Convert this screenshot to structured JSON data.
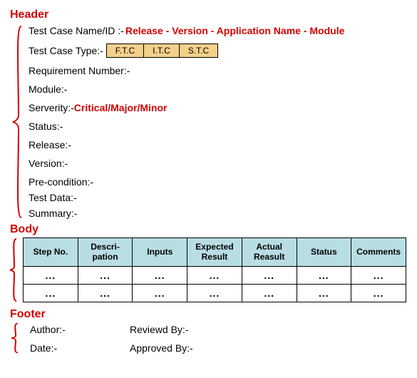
{
  "sections": {
    "header_title": "Header",
    "body_title": "Body",
    "footer_title": "Footer"
  },
  "header": {
    "name_id_label": "Test Case Name/ID :-",
    "name_id_value": "Release - Version - Application Name - Module",
    "type_label": "Test Case Type:-",
    "type_options": [
      "F.T.C",
      "I.T.C",
      "S.T.C"
    ],
    "requirement_label": "Requirement Number:-",
    "module_label": "Module:-",
    "severity_label": "Serverity:- ",
    "severity_value": "Critical/Major/Minor",
    "status_label": "Status:-",
    "release_label": "Release:-",
    "version_label": "Version:-",
    "precondition_label": "Pre-condition:-",
    "testdata_label": "Test Data:-",
    "summary_label": "Summary:-"
  },
  "body": {
    "columns": [
      "Step No.",
      "Descri-\npation",
      "Inputs",
      "Expected\nResult",
      "Actual\nReasult",
      "Status",
      "Comments"
    ],
    "rows": [
      [
        "...",
        "...",
        "...",
        "...",
        "...",
        "...",
        "..."
      ],
      [
        "...",
        "...",
        "...",
        "...",
        "...",
        "...",
        "..."
      ]
    ]
  },
  "footer": {
    "author_label": "Author:-",
    "reviewed_label": "Reviewd By:-",
    "date_label": "Date:-",
    "approved_label": "Approved By:-"
  }
}
